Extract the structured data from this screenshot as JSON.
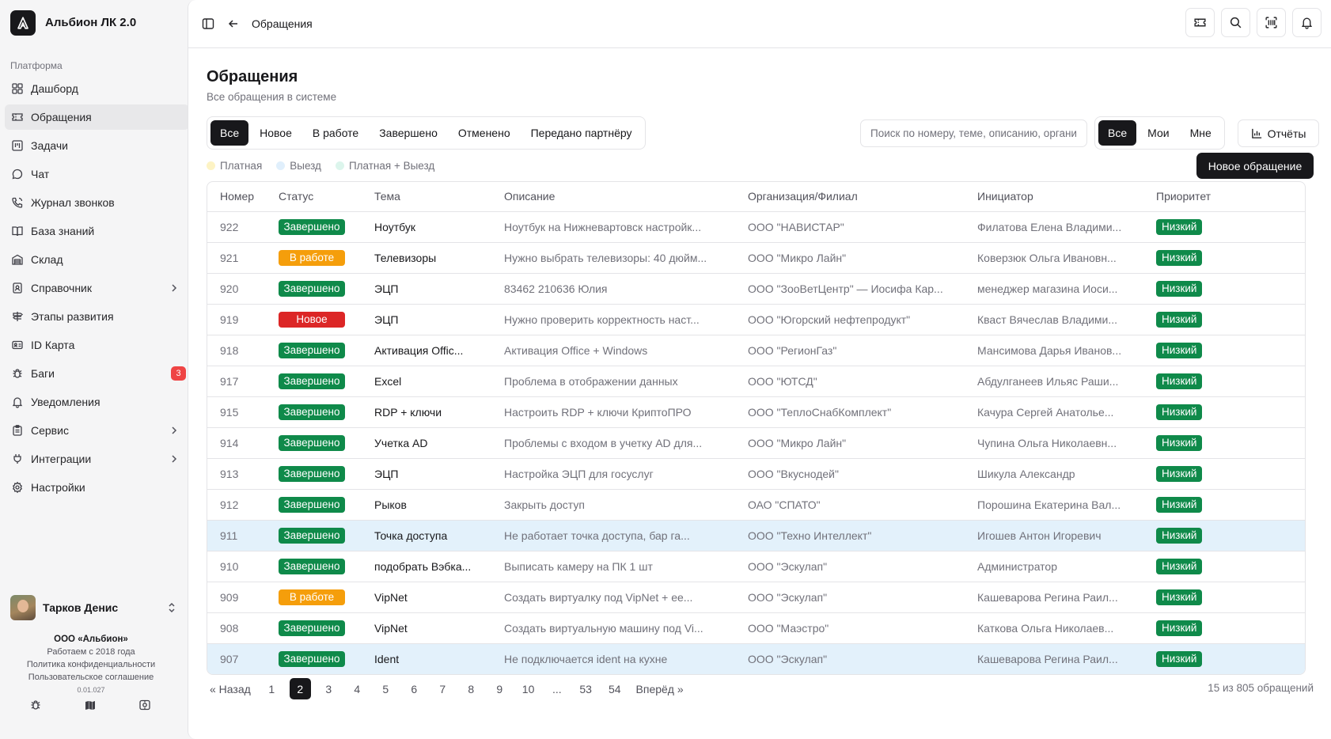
{
  "app": {
    "name": "Альбион ЛК 2.0"
  },
  "sidebar": {
    "group_label": "Платформа",
    "items": [
      {
        "label": "Дашборд",
        "icon": "grid-icon"
      },
      {
        "label": "Обращения",
        "icon": "ticket-icon",
        "active": true
      },
      {
        "label": "Задачи",
        "icon": "kanban-icon"
      },
      {
        "label": "Чат",
        "icon": "chat-icon"
      },
      {
        "label": "Журнал звонков",
        "icon": "phone-icon"
      },
      {
        "label": "База знаний",
        "icon": "book-icon"
      },
      {
        "label": "Склад",
        "icon": "warehouse-icon"
      },
      {
        "label": "Справочник",
        "icon": "contacts-icon",
        "chevron": true
      },
      {
        "label": "Этапы развития",
        "icon": "signpost-icon"
      },
      {
        "label": "ID Карта",
        "icon": "id-card-icon"
      },
      {
        "label": "Баги",
        "icon": "bug-icon",
        "badge": "3"
      },
      {
        "label": "Уведомления",
        "icon": "bell-icon"
      },
      {
        "label": "Сервис",
        "icon": "clipboard-icon",
        "chevron": true
      },
      {
        "label": "Интеграции",
        "icon": "plug-icon",
        "chevron": true
      },
      {
        "label": "Настройки",
        "icon": "gear-icon"
      }
    ],
    "user": {
      "name": "Тарков Денис"
    },
    "company": {
      "name": "ООО «Альбион»",
      "since": "Работаем с 2018 года",
      "privacy": "Политика конфиденциальности",
      "terms": "Пользовательское соглашение",
      "version": "0.01.027"
    }
  },
  "topbar": {
    "breadcrumb": "Обращения"
  },
  "page": {
    "title": "Обращения",
    "subtitle": "Все обращения в системе"
  },
  "tabs": [
    "Все",
    "Новое",
    "В работе",
    "Завершено",
    "Отменено",
    "Передано партнёру"
  ],
  "legend": [
    {
      "label": "Платная",
      "color": "#fdf3c4"
    },
    {
      "label": "Выезд",
      "color": "#e0effc"
    },
    {
      "label": "Платная + Выезд",
      "color": "#dcf5ec"
    }
  ],
  "search": {
    "placeholder": "Поиск по номеру, теме, описанию, организации"
  },
  "scope": [
    "Все",
    "Мои",
    "Мне"
  ],
  "reports_label": "Отчёты",
  "new_label": "Новое обращение",
  "colors": {
    "done": "#0f8a4a",
    "work": "#f59e0b",
    "new": "#dc2626",
    "highlight": "#e3f1fb"
  },
  "table": {
    "columns": [
      "Номер",
      "Статус",
      "Тема",
      "Описание",
      "Организация/Филиал",
      "Инициатор",
      "Приоритет"
    ],
    "rows": [
      {
        "num": "922",
        "status": "Завершено",
        "kind": "done",
        "topic": "Ноутбук",
        "desc": "Ноутбук на Нижневартовск настройк...",
        "org": "ООО \"НАВИСТАР\"",
        "init": "Филатова Елена Владими...",
        "prio": "Низкий"
      },
      {
        "num": "921",
        "status": "В работе",
        "kind": "work",
        "topic": "Телевизоры",
        "desc": "Нужно выбрать телевизоры: 40 дюйм...",
        "org": "ООО \"Микро Лайн\"",
        "init": "Коверзюк Ольга Ивановн...",
        "prio": "Низкий"
      },
      {
        "num": "920",
        "status": "Завершено",
        "kind": "done",
        "topic": "ЭЦП",
        "desc": "83462 210636 Юлия",
        "org": "ООО \"ЗооВетЦентр\" — Иосифа Кар...",
        "init": "менеджер магазина Иоси...",
        "prio": "Низкий"
      },
      {
        "num": "919",
        "status": "Новое",
        "kind": "new",
        "topic": "ЭЦП",
        "desc": "Нужно проверить корректность наст...",
        "org": "ООО \"Югорский нефтепродукт\"",
        "init": "Кваст Вячеслав Владими...",
        "prio": "Низкий"
      },
      {
        "num": "918",
        "status": "Завершено",
        "kind": "done",
        "topic": "Активация Offic...",
        "desc": "Активация Office + Windows",
        "org": "ООО \"РегионГаз\"",
        "init": "Мансимова Дарья Иванов...",
        "prio": "Низкий"
      },
      {
        "num": "917",
        "status": "Завершено",
        "kind": "done",
        "topic": "Excel",
        "desc": "Проблема в отображении данных",
        "org": "ООО \"ЮТСД\"",
        "init": "Абдулганеев Ильяс Раши...",
        "prio": "Низкий"
      },
      {
        "num": "915",
        "status": "Завершено",
        "kind": "done",
        "topic": "RDP + ключи",
        "desc": "Настроить RDP + ключи КриптоПРО",
        "org": "ООО \"ТеплоСнабКомплект\"",
        "init": "Качура Сергей Анатолье...",
        "prio": "Низкий"
      },
      {
        "num": "914",
        "status": "Завершено",
        "kind": "done",
        "topic": "Учетка AD",
        "desc": "Проблемы с входом в учетку AD для...",
        "org": "ООО \"Микро Лайн\"",
        "init": "Чупина Ольга Николаевн...",
        "prio": "Низкий"
      },
      {
        "num": "913",
        "status": "Завершено",
        "kind": "done",
        "topic": "ЭЦП",
        "desc": "Настройка ЭЦП для госуслуг",
        "org": "ООО \"Вкуснодей\"",
        "init": "Шикула Александр",
        "prio": "Низкий"
      },
      {
        "num": "912",
        "status": "Завершено",
        "kind": "done",
        "topic": "Рыков",
        "desc": "Закрыть доступ",
        "org": "ОАО \"СПАТО\"",
        "init": "Порошина Екатерина Вал...",
        "prio": "Низкий"
      },
      {
        "num": "911",
        "status": "Завершено",
        "kind": "done",
        "topic": "Точка доступа",
        "desc": "Не работает точка доступа, бар га...",
        "org": "ООО \"Техно Интеллект\"",
        "init": "Игошев Антон Игоревич",
        "prio": "Низкий",
        "hl": true
      },
      {
        "num": "910",
        "status": "Завершено",
        "kind": "done",
        "topic": "подобрать Вэбка...",
        "desc": "Выписать камеру на ПК 1 шт",
        "org": "ООО \"Эскулап\"",
        "init": "Администратор",
        "prio": "Низкий"
      },
      {
        "num": "909",
        "status": "В работе",
        "kind": "work",
        "topic": "VipNet",
        "desc": "Создать виртуалку под VipNet + ее...",
        "org": "ООО \"Эскулап\"",
        "init": "Кашеварова Регина Раил...",
        "prio": "Низкий"
      },
      {
        "num": "908",
        "status": "Завершено",
        "kind": "done",
        "topic": "VipNet",
        "desc": "Создать виртуальную машину под Vi...",
        "org": "ООО \"Маэстро\"",
        "init": "Каткова Ольга Николаев...",
        "prio": "Низкий"
      },
      {
        "num": "907",
        "status": "Завершено",
        "kind": "done",
        "topic": "Ident",
        "desc": "Не подключается ident на кухне",
        "org": "ООО \"Эскулап\"",
        "init": "Кашеварова Регина Раил...",
        "prio": "Низкий",
        "hl": true
      }
    ]
  },
  "pagination": {
    "prev": "« Назад",
    "next": "Вперёд »",
    "pages": [
      "1",
      "2",
      "3",
      "4",
      "5",
      "6",
      "7",
      "8",
      "9",
      "10",
      "...",
      "53",
      "54"
    ],
    "current": "2",
    "total": "15 из 805 обращений"
  }
}
